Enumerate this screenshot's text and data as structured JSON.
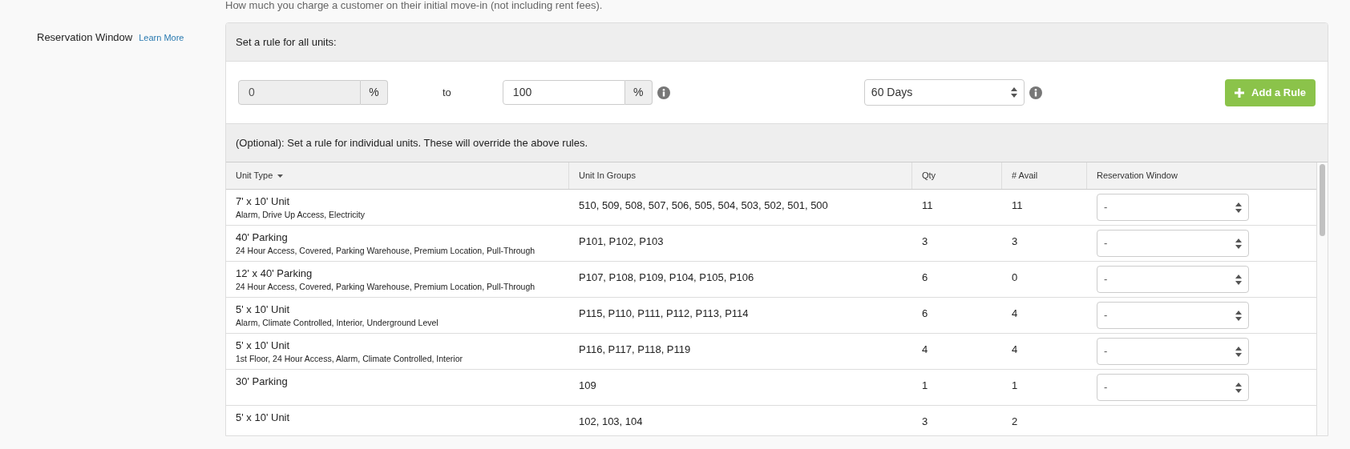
{
  "help_text": "How much you charge a customer on their initial move-in (not including rent fees).",
  "section": {
    "label": "Reservation Window",
    "link": "Learn More"
  },
  "all_units": {
    "title": "Set a rule for all units:",
    "from": {
      "value": "0",
      "unit": "%",
      "disabled": true
    },
    "separator": "to",
    "to": {
      "value": "100",
      "unit": "%",
      "disabled": false
    },
    "period": "60 Days",
    "button": "Add a Rule"
  },
  "individual": {
    "title": "(Optional): Set a rule for individual units. These will override the above rules."
  },
  "table": {
    "columns": [
      {
        "label": "Unit Type",
        "sorted": true
      },
      {
        "label": "Unit In Groups",
        "sorted": false
      },
      {
        "label": "Qty",
        "sorted": false
      },
      {
        "label": "# Avail",
        "sorted": false
      },
      {
        "label": "Reservation Window",
        "sorted": false
      }
    ],
    "rows": [
      {
        "type": "7' x 10' Unit",
        "features": "Alarm, Drive Up Access, Electricity",
        "groups": "510, 509, 508, 507, 506, 505, 504, 503, 502, 501, 500",
        "qty": "11",
        "avail": "11",
        "window": "-"
      },
      {
        "type": "40' Parking",
        "features": "24 Hour Access, Covered, Parking Warehouse, Premium Location, Pull-Through",
        "groups": "P101, P102, P103",
        "qty": "3",
        "avail": "3",
        "window": "-"
      },
      {
        "type": "12' x 40' Parking",
        "features": "24 Hour Access, Covered, Parking Warehouse, Premium Location, Pull-Through",
        "groups": "P107, P108, P109, P104, P105, P106",
        "qty": "6",
        "avail": "0",
        "window": "-"
      },
      {
        "type": "5' x 10' Unit",
        "features": "Alarm, Climate Controlled, Interior, Underground Level",
        "groups": "P115, P110, P111, P112, P113, P114",
        "qty": "6",
        "avail": "4",
        "window": "-"
      },
      {
        "type": "5' x 10' Unit",
        "features": "1st Floor, 24 Hour Access, Alarm, Climate Controlled, Interior",
        "groups": "P116, P117, P118, P119",
        "qty": "4",
        "avail": "4",
        "window": "-"
      },
      {
        "type": "30' Parking",
        "groups": "109",
        "qty": "1",
        "avail": "1",
        "window": "-"
      },
      {
        "type": "5' x 10' Unit",
        "groups": "102, 103, 104",
        "qty": "3",
        "avail": "2"
      }
    ]
  }
}
